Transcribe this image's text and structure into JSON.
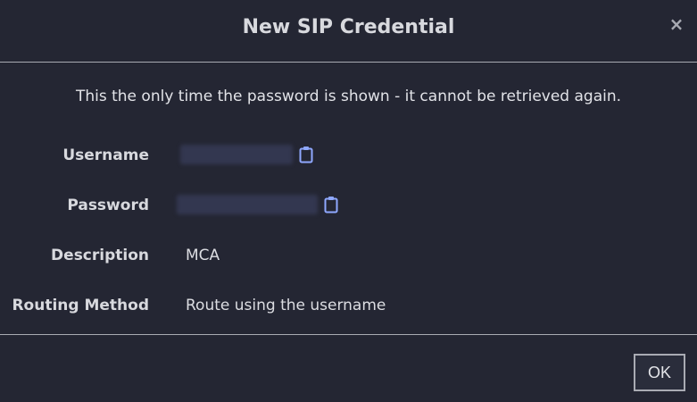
{
  "dialog": {
    "title": "New SIP Credential",
    "close_label": "×",
    "notice": "This the only time the password is shown - it cannot be retrieved again."
  },
  "fields": {
    "username": {
      "label": "Username",
      "value_redacted": true,
      "copy_icon": "clipboard-icon"
    },
    "password": {
      "label": "Password",
      "value_redacted": true,
      "copy_icon": "clipboard-icon"
    },
    "description": {
      "label": "Description",
      "value": "MCA"
    },
    "routing_method": {
      "label": "Routing Method",
      "value": "Route using the username"
    }
  },
  "footer": {
    "ok_label": "OK"
  },
  "colors": {
    "background": "#242633",
    "divider": "#a9abb3",
    "icon_accent": "#8fa8ff",
    "text": "#e3e4e8"
  }
}
